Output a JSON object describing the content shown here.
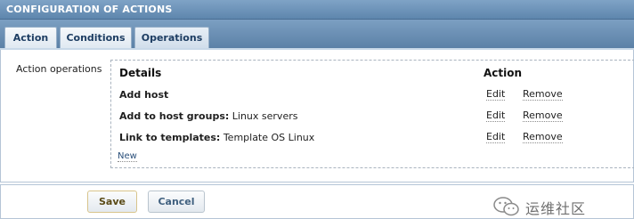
{
  "header": {
    "title": "CONFIGURATION OF ACTIONS"
  },
  "tabs": [
    {
      "label": "Action",
      "active": false
    },
    {
      "label": "Conditions",
      "active": false
    },
    {
      "label": "Operations",
      "active": true
    }
  ],
  "form": {
    "row_label": "Action operations"
  },
  "operations": {
    "columns": {
      "details": "Details",
      "action": "Action"
    },
    "rows": [
      {
        "bold": "Add host",
        "text": "",
        "edit": "Edit",
        "remove": "Remove"
      },
      {
        "bold": "Add to host groups:",
        "text": " Linux servers",
        "edit": "Edit",
        "remove": "Remove"
      },
      {
        "bold": "Link to templates:",
        "text": " Template OS Linux",
        "edit": "Edit",
        "remove": "Remove"
      }
    ],
    "new_label": "New"
  },
  "buttons": {
    "save": "Save",
    "cancel": "Cancel"
  },
  "watermark": {
    "text": "运维社区",
    "icon": "wechat-icon"
  },
  "colors": {
    "header_bg": "#6a90b6",
    "tab_text": "#1d3d62",
    "save_border": "#d8c48c"
  }
}
